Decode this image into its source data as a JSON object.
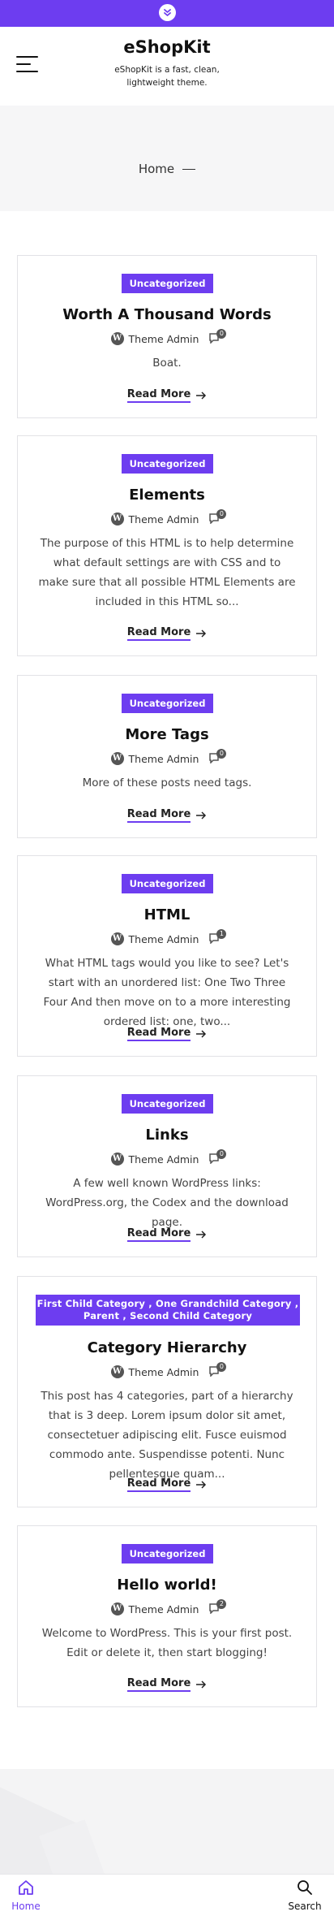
{
  "site": {
    "title": "eShopKit",
    "description": "eShopKit is a fast, clean, lightweight theme."
  },
  "breadcrumb": {
    "label": "Home"
  },
  "read_more_label": "Read More",
  "author_name": "Theme Admin",
  "posts": [
    {
      "category": "Uncategorized",
      "title": "Worth A Thousand Words",
      "comments": "0",
      "excerpt": "Boat."
    },
    {
      "category": "Uncategorized",
      "title": "Elements",
      "comments": "0",
      "excerpt": "The purpose of this HTML is to help determine what default settings are with CSS and to make sure that all possible HTML Elements are included in this HTML so..."
    },
    {
      "category": "Uncategorized",
      "title": "More Tags",
      "comments": "0",
      "excerpt": "More of these posts need tags."
    },
    {
      "category": "Uncategorized",
      "title": "HTML",
      "comments": "1",
      "excerpt": "What HTML tags would you like to see? Let's start with an unordered list: One Two Three Four And then move on to a more interesting ordered list: one, two..."
    },
    {
      "category": "Uncategorized",
      "title": "Links",
      "comments": "0",
      "excerpt": "A few well known WordPress links: WordPress.org, the Codex and the download page."
    },
    {
      "category": "First Child Category , One Grandchild Category , Parent , Second Child Category",
      "title": "Category Hierarchy",
      "comments": "0",
      "excerpt": "This post has 4 categories, part of a hierarchy that is 3 deep. Lorem ipsum dolor sit amet, consectetuer adipiscing elit. Fusce euismod commodo ante. Suspendisse potenti. Nunc pellentesque quam..."
    },
    {
      "category": "Uncategorized",
      "title": "Hello world!",
      "comments": "2",
      "excerpt": "Welcome to WordPress. This is your first post. Edit or delete it, then start blogging!"
    }
  ],
  "bottom_nav": {
    "home_label": "Home",
    "search_label": "Search"
  },
  "colors": {
    "accent": "#6d3df0"
  },
  "icons": {
    "top_toggle": "chevron-double-down-icon",
    "menu": "hamburger-menu-icon",
    "author": "wordpress-icon",
    "comments": "comment-bubble-icon",
    "read_more": "arrow-right-icon",
    "home": "home-icon",
    "search": "search-icon"
  }
}
